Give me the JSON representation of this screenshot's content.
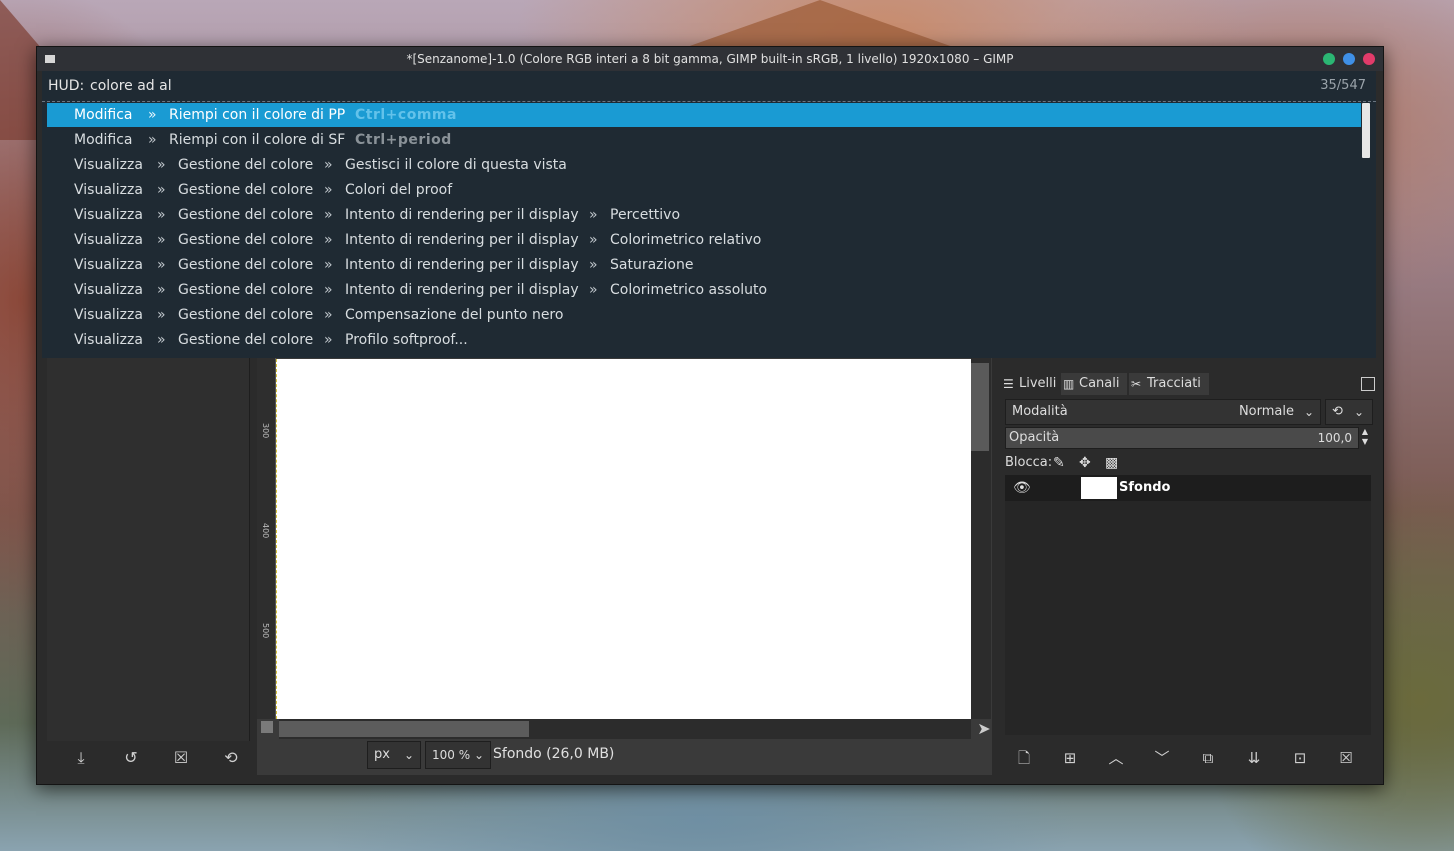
{
  "window": {
    "title": "*[Senzanome]-1.0 (Colore RGB interi a 8 bit gamma, GIMP built-in sRGB, 1 livello) 1920x1080 – GIMP",
    "controls": {
      "minimize_color": "#2bb673",
      "maximize_color": "#3f8fe6",
      "close_color": "#e23b6a"
    }
  },
  "hud": {
    "label": "HUD:",
    "query": "colore ad al",
    "count": "35/547",
    "results": [
      {
        "segments": [
          "Modifica",
          "Riempi con il colore di PP"
        ],
        "shortcut": "Ctrl+comma",
        "selected": true
      },
      {
        "segments": [
          "Modifica",
          "Riempi con il colore di SF"
        ],
        "shortcut": "Ctrl+period",
        "selected": false
      },
      {
        "segments": [
          "Visualizza",
          "Gestione del colore",
          "Gestisci il colore di questa vista"
        ],
        "shortcut": "",
        "selected": false
      },
      {
        "segments": [
          "Visualizza",
          "Gestione del colore",
          "Colori del proof"
        ],
        "shortcut": "",
        "selected": false
      },
      {
        "segments": [
          "Visualizza",
          "Gestione del colore",
          "Intento di rendering per il display",
          "Percettivo"
        ],
        "shortcut": "",
        "selected": false
      },
      {
        "segments": [
          "Visualizza",
          "Gestione del colore",
          "Intento di rendering per il display",
          "Colorimetrico relativo"
        ],
        "shortcut": "",
        "selected": false
      },
      {
        "segments": [
          "Visualizza",
          "Gestione del colore",
          "Intento di rendering per il display",
          "Saturazione"
        ],
        "shortcut": "",
        "selected": false
      },
      {
        "segments": [
          "Visualizza",
          "Gestione del colore",
          "Intento di rendering per il display",
          "Colorimetrico assoluto"
        ],
        "shortcut": "",
        "selected": false
      },
      {
        "segments": [
          "Visualizza",
          "Gestione del colore",
          "Compensazione del punto nero"
        ],
        "shortcut": "",
        "selected": false
      },
      {
        "segments": [
          "Visualizza",
          "Gestione del colore",
          "Profilo softproof..."
        ],
        "shortcut": "",
        "selected": false
      }
    ],
    "separator": "»"
  },
  "ruler": {
    "labels": [
      "300",
      "400",
      "500"
    ]
  },
  "statusbar": {
    "unit": "px",
    "zoom": "100 %",
    "info": "Sfondo (26,0 MB)"
  },
  "layers_dock": {
    "tabs": [
      {
        "label": "Livelli",
        "icon": "layers-icon"
      },
      {
        "label": "Canali",
        "icon": "channels-icon"
      },
      {
        "label": "Tracciati",
        "icon": "paths-icon"
      }
    ],
    "mode_label": "Modalità",
    "mode_value": "Normale",
    "opacity_label": "Opacità",
    "opacity_value": "100,0",
    "lock_label": "Blocca:",
    "layers": [
      {
        "name": "Sfondo",
        "visible": true
      }
    ]
  },
  "left_toolbar": [
    "save-icon",
    "restore-icon",
    "delete-icon",
    "reset-icon"
  ],
  "dock_toolbar": [
    "new-layer-icon",
    "new-group-icon",
    "raise-icon",
    "lower-icon",
    "duplicate-icon",
    "merge-icon",
    "mask-icon",
    "delete-layer-icon"
  ]
}
